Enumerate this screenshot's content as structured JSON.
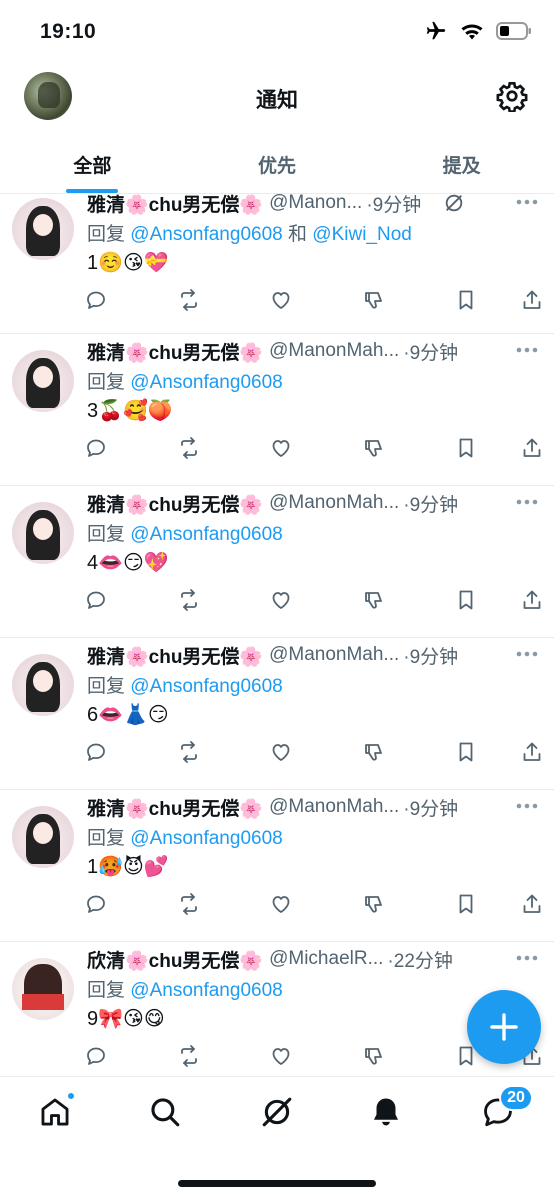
{
  "status_bar": {
    "time": "19:10"
  },
  "header": {
    "title": "通知"
  },
  "tabs": [
    {
      "label": "全部",
      "active": true
    },
    {
      "label": "优先",
      "active": false
    },
    {
      "label": "提及",
      "active": false
    }
  ],
  "tweets": [
    {
      "name": "雅清🌸chu男无偿🌸",
      "handle": "@Manon...",
      "time": "·9分钟",
      "reply_prefix": "回复",
      "mentions": [
        "@Ansonfang0608",
        "@Kiwi_Nod"
      ],
      "joiner": "和",
      "body": "1☺️😘💝"
    },
    {
      "name": "雅清🌸chu男无偿🌸",
      "handle": "@ManonMah...",
      "time": "·9分钟",
      "reply_prefix": "回复",
      "mentions": [
        "@Ansonfang0608"
      ],
      "body": "3🍒🥰🍑"
    },
    {
      "name": "雅清🌸chu男无偿🌸",
      "handle": "@ManonMah...",
      "time": "·9分钟",
      "reply_prefix": "回复",
      "mentions": [
        "@Ansonfang0608"
      ],
      "body": "4👄😏💖"
    },
    {
      "name": "雅清🌸chu男无偿🌸",
      "handle": "@ManonMah...",
      "time": "·9分钟",
      "reply_prefix": "回复",
      "mentions": [
        "@Ansonfang0608"
      ],
      "body": "6👄👗😏"
    },
    {
      "name": "雅清🌸chu男无偿🌸",
      "handle": "@ManonMah...",
      "time": "·9分钟",
      "reply_prefix": "回复",
      "mentions": [
        "@Ansonfang0608"
      ],
      "body": "1🥵😈💕"
    },
    {
      "name": "欣清🌸chu男无偿🌸",
      "handle": "@MichaelR...",
      "time": "·22分钟",
      "reply_prefix": "回复",
      "mentions": [
        "@Ansonfang0608"
      ],
      "body": "9🎀😘😋"
    }
  ],
  "bottom_nav": {
    "messages_badge": "20"
  },
  "icons": {
    "status": [
      "airplane-icon",
      "wifi-icon",
      "battery-icon"
    ],
    "header": [
      "settings-gear-icon"
    ],
    "tweet_actions": [
      "reply-icon",
      "retweet-icon",
      "like-icon",
      "dislike-icon",
      "bookmark-icon",
      "share-icon"
    ],
    "nav": [
      "home-icon",
      "search-icon",
      "grok-icon",
      "notifications-bell-icon",
      "messages-icon"
    ]
  },
  "colors": {
    "accent": "#1d9bf0",
    "text": "#0f1419",
    "muted": "#536471"
  }
}
